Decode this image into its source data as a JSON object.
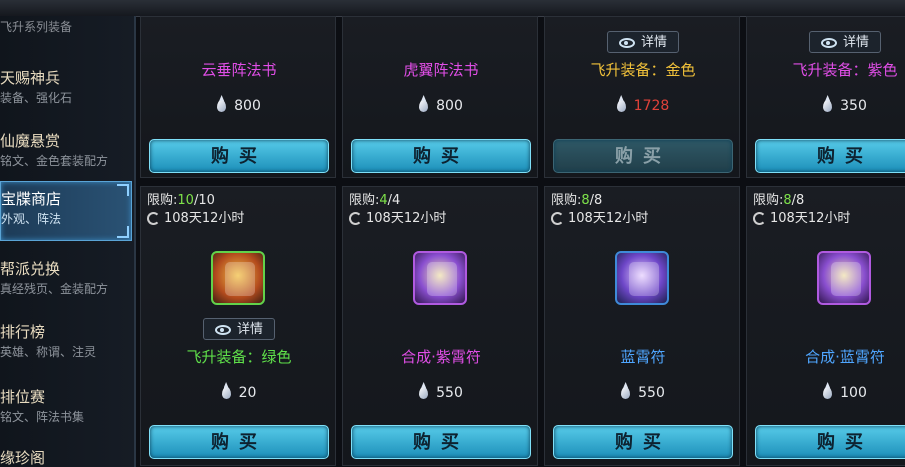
{
  "sidebar": {
    "top_label": "飞升系列装备",
    "items": [
      {
        "title": "天赐神兵",
        "sub": "装备、强化石"
      },
      {
        "title": "仙魔悬赏",
        "sub": "铭文、金色套装配方"
      },
      {
        "title": "宝牒商店",
        "sub": "外观、阵法"
      },
      {
        "title": "帮派兑换",
        "sub": "真经残页、金装配方"
      },
      {
        "title": "排行榜",
        "sub": "英雄、称谓、注灵"
      },
      {
        "title": "排位赛",
        "sub": "铭文、阵法书集"
      },
      {
        "title": "缘珍阁",
        "sub": ""
      }
    ]
  },
  "buy_label": "购买",
  "detail_label": "详情",
  "top_row": [
    {
      "name": "云垂阵法书",
      "price": "800",
      "price_color": "#e8eaee",
      "name_color": "#e04ee6",
      "detail": false,
      "buy_enabled": true
    },
    {
      "name": "虎翼阵法书",
      "price": "800",
      "price_color": "#e8eaee",
      "name_color": "#e04ee6",
      "detail": false,
      "buy_enabled": true
    },
    {
      "name": "飞升装备：金色",
      "price": "1728",
      "price_color": "#e0423a",
      "name_color": "#f2c23a",
      "detail": true,
      "buy_enabled": false
    },
    {
      "name": "飞升装备：紫色",
      "price": "350",
      "price_color": "#e8eaee",
      "name_color": "#e04ee6",
      "detail": true,
      "buy_enabled": true
    }
  ],
  "bottom_row": [
    {
      "limit_label": "限购:",
      "limit_have": "10",
      "limit_total": "/10",
      "timer": "108天12小时",
      "name": "飞升装备：绿色",
      "name_color": "#5fe04a",
      "price": "20",
      "detail": true,
      "icon": "gift-box-icon"
    },
    {
      "limit_label": "限购:",
      "limit_have": "4",
      "limit_total": "/4",
      "timer": "108天12小时",
      "name": "合成·紫霄符",
      "name_color": "#e04ee6",
      "price": "550",
      "detail": false,
      "icon": "purple-scroll-icon"
    },
    {
      "limit_label": "限购:",
      "limit_have": "8",
      "limit_total": "/8",
      "timer": "108天12小时",
      "name": "蓝霄符",
      "name_color": "#4fa6ff",
      "price": "550",
      "detail": false,
      "icon": "blue-scroll-icon"
    },
    {
      "limit_label": "限购:",
      "limit_have": "8",
      "limit_total": "/8",
      "timer": "108天12小时",
      "name": "合成·蓝霄符",
      "name_color": "#4fa6ff",
      "price": "100",
      "detail": false,
      "icon": "purple-scroll-icon"
    }
  ]
}
